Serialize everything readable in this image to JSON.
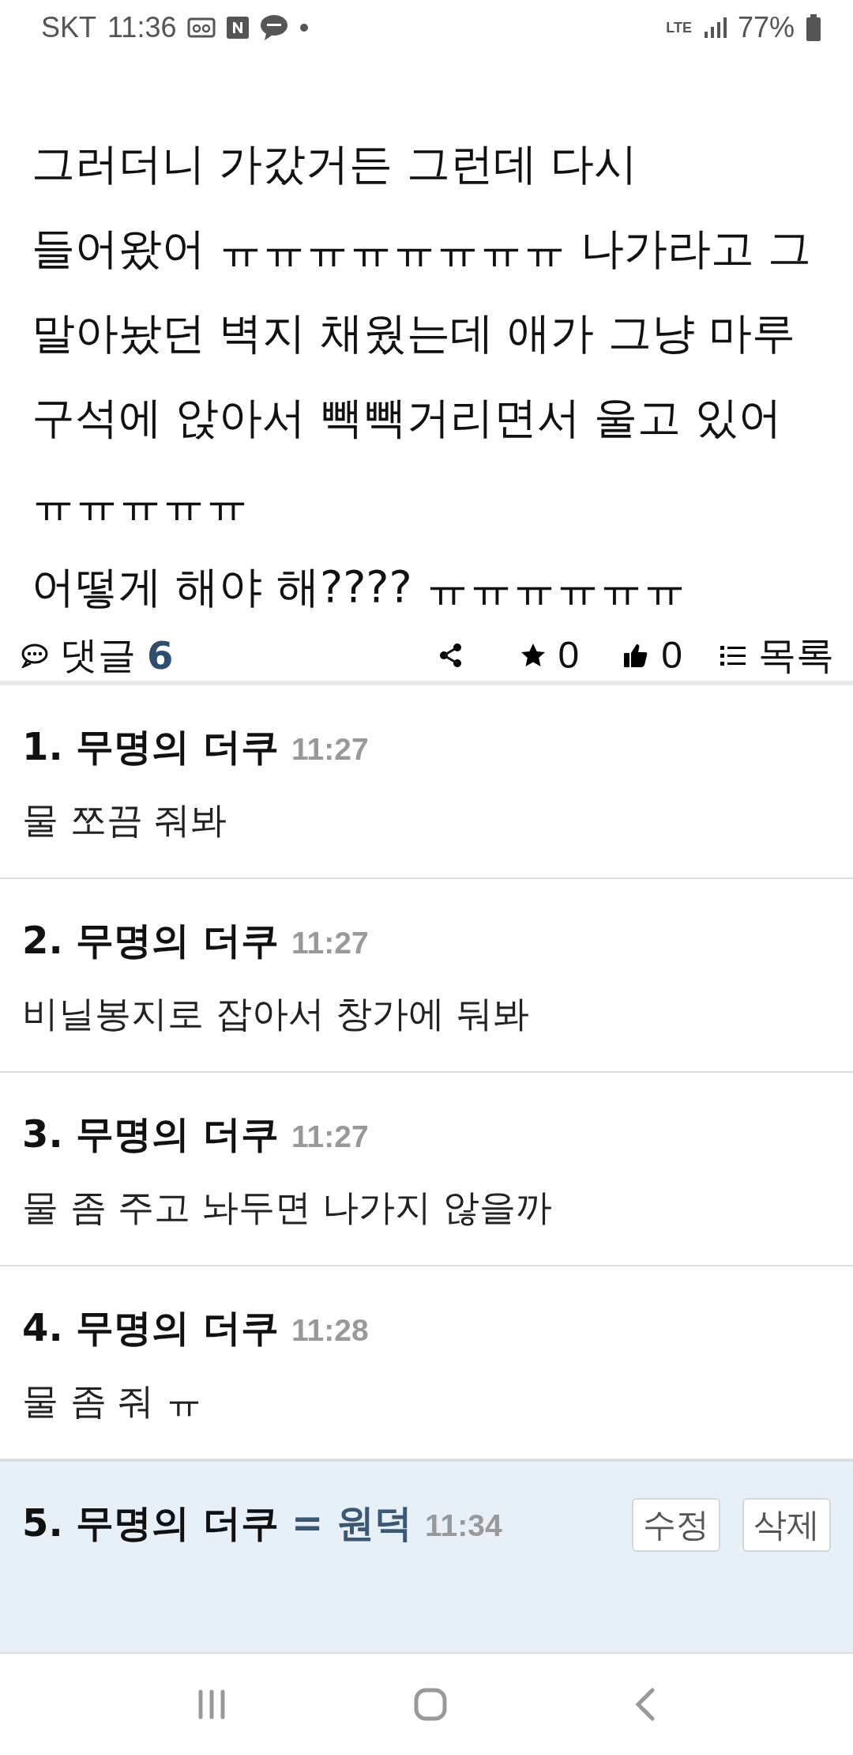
{
  "status_bar": {
    "carrier": "SKT",
    "time": "11:36",
    "network": "LTE",
    "battery": "77%"
  },
  "post": {
    "paragraphs": [
      "그러더니 가갔거든 그런데 다시 들어왔어 ㅠㅠㅠㅠㅠㅠㅠㅠ 나가라고 그 말아놨던 벽지 채웠는데 애가 그냥 마루 구석에 앉아서 빽빽거리면서 울고 있어 ㅠㅠㅠㅠㅠ",
      "어떻게 해야 해???? ㅠㅠㅠㅠㅠㅠ"
    ]
  },
  "comment_bar": {
    "label": "댓글",
    "count": "6",
    "stars": "0",
    "likes": "0",
    "list_label": "목록"
  },
  "comments": [
    {
      "number": "1.",
      "author": "무명의 더쿠",
      "time": "11:27",
      "body": "물 쪼끔 줘봐",
      "mine": false
    },
    {
      "number": "2.",
      "author": "무명의 더쿠",
      "time": "11:27",
      "body": "비닐봉지로 잡아서 창가에 둬봐",
      "mine": false
    },
    {
      "number": "3.",
      "author": "무명의 더쿠",
      "time": "11:27",
      "body": "물 좀 주고 놔두면 나가지 않을까",
      "mine": false
    },
    {
      "number": "4.",
      "author": "무명의 더쿠",
      "time": "11:28",
      "body": "물 좀 줘 ㅠ",
      "mine": false
    },
    {
      "number": "5.",
      "author": "무명의 더쿠",
      "tag": "= 원덕",
      "time": "11:34",
      "mine": true,
      "actions": [
        "수정",
        "삭제"
      ]
    }
  ]
}
